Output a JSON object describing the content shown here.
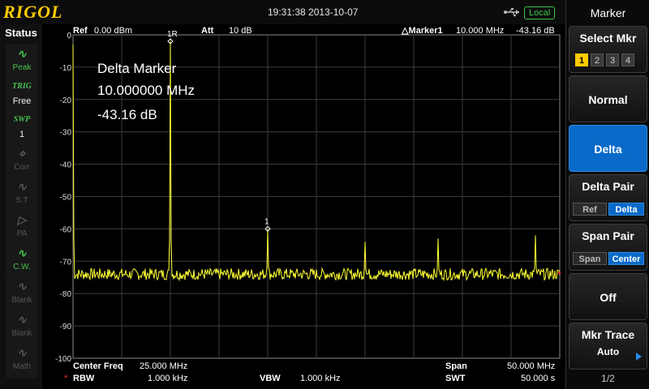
{
  "header": {
    "logo": "RIGOL",
    "datetime": "19:31:38 2013-10-07",
    "local": "Local",
    "usb_icon": "usb-icon"
  },
  "status": {
    "title": "Status",
    "items": [
      {
        "icon": "peak-icon",
        "glyph": "∿",
        "label": "Peak",
        "active": true
      },
      {
        "icon": "trig-icon",
        "glyph": "TRIG",
        "label": "Free",
        "active": true
      },
      {
        "icon": "sweep-icon",
        "glyph": "SWP",
        "label": "1",
        "active": true
      },
      {
        "icon": "corr-icon",
        "glyph": "⋄",
        "label": "Corr",
        "active": false
      },
      {
        "icon": "st-icon",
        "glyph": "∿",
        "label": "S.T",
        "active": false
      },
      {
        "icon": "pa-icon",
        "glyph": "▷",
        "label": "PA",
        "active": false
      },
      {
        "icon": "cw-icon",
        "glyph": "∿",
        "label": "C.W.",
        "active": true
      },
      {
        "icon": "blank-icon",
        "glyph": "∿",
        "label": "Blank",
        "active": false
      },
      {
        "icon": "blank-icon",
        "glyph": "∿",
        "label": "Blank",
        "active": false
      },
      {
        "icon": "math-icon",
        "glyph": "∿",
        "label": "Math",
        "active": false
      }
    ]
  },
  "plot_header": {
    "ref_label": "Ref",
    "ref_value": "0.00 dBm",
    "att_label": "Att",
    "att_value": "10 dB",
    "marker_label": "△Marker1",
    "marker_freq": "10.000 MHz",
    "marker_level": "-43.16 dB"
  },
  "delta_box": {
    "title": "Delta Marker",
    "freq": "10.000000 MHz",
    "level": "-43.16 dB"
  },
  "markers": {
    "delta_label": "1R",
    "ref_label": "1"
  },
  "footer": {
    "center_label": "Center Freq",
    "center_value": "25.000 MHz",
    "span_label": "Span",
    "span_value": "50.000 MHz",
    "rbw_star": "*",
    "rbw_label": "RBW",
    "rbw_value": "1.000 kHz",
    "vbw_label": "VBW",
    "vbw_value": "1.000 kHz",
    "swt_label": "SWT",
    "swt_value": "50.000 s"
  },
  "chart_data": {
    "type": "line",
    "y_ticks": [
      "0",
      "-10",
      "-20",
      "-30",
      "-40",
      "-50",
      "-60",
      "-70",
      "-80",
      "-90",
      "-100"
    ],
    "ylim": [
      -100,
      0
    ],
    "xlim": [
      0,
      50
    ],
    "grid": true,
    "noise_floor": -74,
    "peaks": [
      {
        "x": 0,
        "y": -3
      },
      {
        "x": 10,
        "y": -2
      },
      {
        "x": 20,
        "y": -60
      },
      {
        "x": 30,
        "y": -64
      },
      {
        "x": 37.5,
        "y": -63
      },
      {
        "x": 47.5,
        "y": -62
      }
    ],
    "trace_color": "#ffff33"
  },
  "menu": {
    "title": "Marker",
    "select_mkr": "Select Mkr",
    "mkr_numbers": [
      "1",
      "2",
      "3",
      "4"
    ],
    "normal": "Normal",
    "delta": "Delta",
    "delta_pair": "Delta Pair",
    "delta_pair_opts": [
      "Ref",
      "Delta"
    ],
    "span_pair": "Span Pair",
    "span_pair_opts": [
      "Span",
      "Center"
    ],
    "off": "Off",
    "mkr_trace": "Mkr Trace",
    "mkr_trace_value": "Auto",
    "page": "1/2",
    "accent": "#0a6ac9",
    "marker_color": "#ffcc00"
  }
}
